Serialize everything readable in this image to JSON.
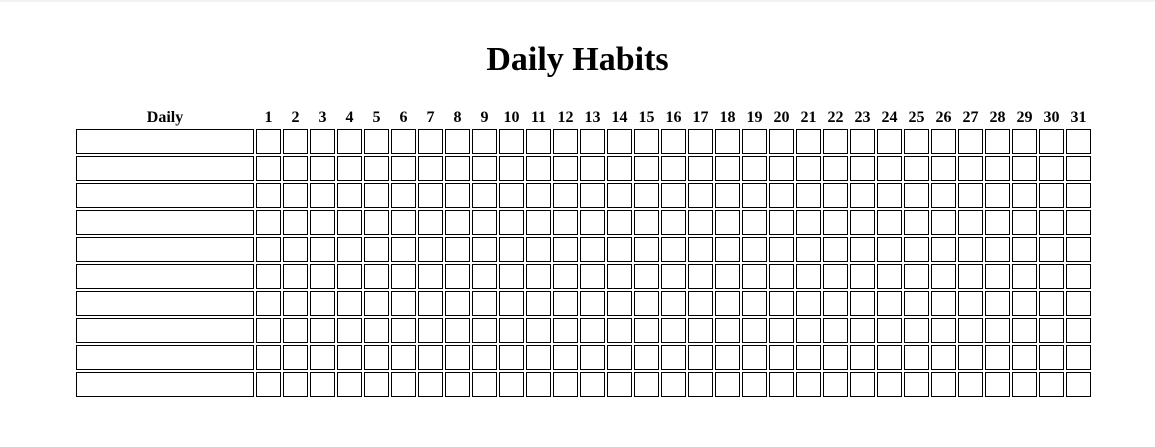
{
  "title": "Daily Habits",
  "tracker": {
    "habit_column_label": "Daily",
    "days": [
      "1",
      "2",
      "3",
      "4",
      "5",
      "6",
      "7",
      "8",
      "9",
      "10",
      "11",
      "12",
      "13",
      "14",
      "15",
      "16",
      "17",
      "18",
      "19",
      "20",
      "21",
      "22",
      "23",
      "24",
      "25",
      "26",
      "27",
      "28",
      "29",
      "30",
      "31"
    ],
    "row_count": 10
  }
}
